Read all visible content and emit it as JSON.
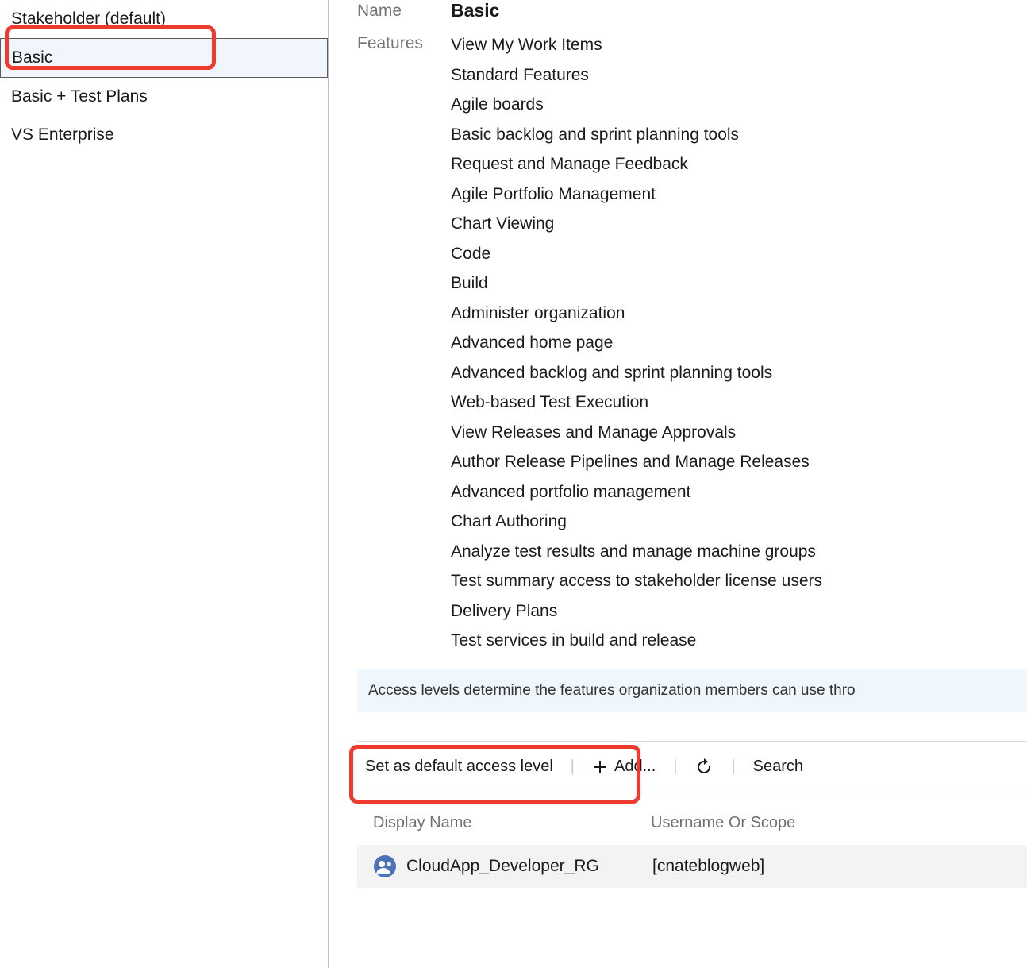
{
  "sidebar": {
    "items": [
      {
        "label": "Stakeholder (default)"
      },
      {
        "label": "Basic"
      },
      {
        "label": "Basic + Test Plans"
      },
      {
        "label": "VS Enterprise"
      }
    ]
  },
  "details": {
    "name_label": "Name",
    "name_value": "Basic",
    "features_label": "Features",
    "features": [
      "View My Work Items",
      "Standard Features",
      "Agile boards",
      "Basic backlog and sprint planning tools",
      "Request and Manage Feedback",
      "Agile Portfolio Management",
      "Chart Viewing",
      "Code",
      "Build",
      "Administer organization",
      "Advanced home page",
      "Advanced backlog and sprint planning tools",
      "Web-based Test Execution",
      "View Releases and Manage Approvals",
      "Author Release Pipelines and Manage Releases",
      "Advanced portfolio management",
      "Chart Authoring",
      "Analyze test results and manage machine groups",
      "Test summary access to stakeholder license users",
      "Delivery Plans",
      "Test services in build and release"
    ]
  },
  "banner": {
    "text": "Access levels determine the features organization members can use thro"
  },
  "toolbar": {
    "set_default": "Set as default access level",
    "add": "Add...",
    "search": "Search"
  },
  "table": {
    "col_display_name": "Display Name",
    "col_username": "Username Or Scope",
    "rows": [
      {
        "display_name": "CloudApp_Developer_RG",
        "username": "[cnateblogweb]"
      }
    ]
  }
}
